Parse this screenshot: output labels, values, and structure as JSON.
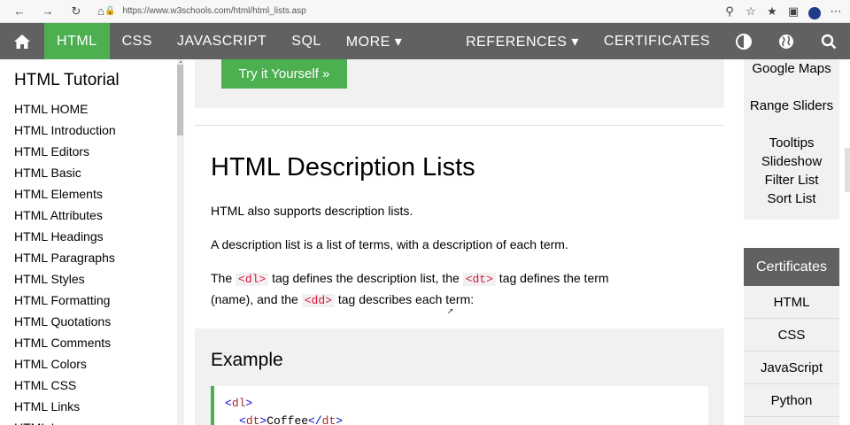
{
  "browser": {
    "url": "https://www.w3schools.com/html/html_lists.asp",
    "icons": [
      "back-icon",
      "forward-icon",
      "reload-icon",
      "home-icon",
      "lock-icon",
      "zoom-icon",
      "favorites-add-icon",
      "favorites-icon",
      "collections-icon",
      "profile-icon",
      "more-icon"
    ]
  },
  "topnav": {
    "html": "HTML",
    "css": "CSS",
    "javascript": "JAVASCRIPT",
    "sql": "SQL",
    "more": "MORE ▾",
    "references": "REFERENCES ▾",
    "certificates": "CERTIFICATES",
    "active_color": "#4caf50",
    "bar_color": "#616161"
  },
  "sidebar": {
    "title": "HTML Tutorial",
    "items": [
      "HTML HOME",
      "HTML Introduction",
      "HTML Editors",
      "HTML Basic",
      "HTML Elements",
      "HTML Attributes",
      "HTML Headings",
      "HTML Paragraphs",
      "HTML Styles",
      "HTML Formatting",
      "HTML Quotations",
      "HTML Comments",
      "HTML Colors",
      "HTML CSS",
      "HTML Links",
      "HTML Images"
    ]
  },
  "main": {
    "try_button": "Try it Yourself »",
    "heading": "HTML Description Lists",
    "p1": "HTML also supports description lists.",
    "p2": "A description list is a list of terms, with a description of each term.",
    "p3": {
      "t1": "The ",
      "c1": "<dl>",
      "t2": " tag defines the description list, the ",
      "c2": "<dt>",
      "t3": " tag defines the term",
      "t4": "(name), and the ",
      "c3": "<dd>",
      "t5": " tag describes each term:"
    },
    "example": {
      "title": "Example",
      "line1_tag": "dl",
      "line2_tag": "dt",
      "line2_text": "Coffee"
    }
  },
  "rightcol": {
    "links": [
      "Google Maps",
      "Range Sliders",
      "Tooltips",
      "Slideshow",
      "Filter List",
      "Sort List"
    ],
    "certificates_header": "Certificates",
    "certificates": [
      "HTML",
      "CSS",
      "JavaScript",
      "Python"
    ]
  }
}
